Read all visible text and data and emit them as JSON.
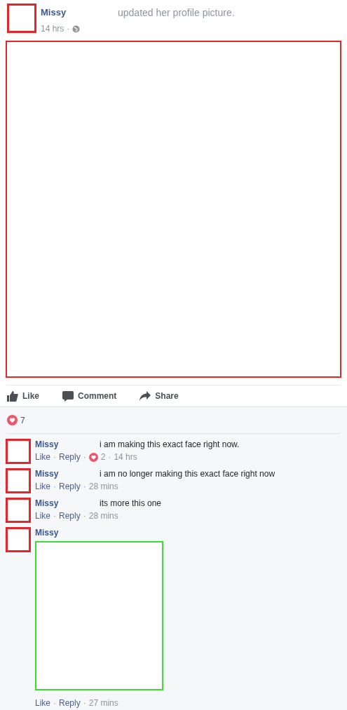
{
  "post": {
    "author": "Missy",
    "action": "updated her profile picture.",
    "time": "14 hrs",
    "separator": "·"
  },
  "actions": [
    {
      "kind": "like",
      "label": "Like"
    },
    {
      "kind": "comment",
      "label": "Comment"
    },
    {
      "kind": "share",
      "label": "Share"
    }
  ],
  "reactions": {
    "count": "7"
  },
  "comments": [
    {
      "author": "Missy",
      "kind": "text",
      "text": "i am making this exact face right now.",
      "meta": [
        {
          "kind": "link",
          "text": "Like"
        },
        {
          "kind": "sep",
          "text": "·"
        },
        {
          "kind": "link",
          "text": "Reply"
        },
        {
          "kind": "sep",
          "text": "·"
        },
        {
          "kind": "reaction",
          "text": "2"
        },
        {
          "kind": "sep",
          "text": "·"
        },
        {
          "kind": "time",
          "text": "14 hrs"
        }
      ]
    },
    {
      "author": "Missy",
      "kind": "text",
      "text": "i am no longer making this exact face right now",
      "meta": [
        {
          "kind": "link",
          "text": "Like"
        },
        {
          "kind": "sep",
          "text": "·"
        },
        {
          "kind": "link",
          "text": "Reply"
        },
        {
          "kind": "sep",
          "text": "·"
        },
        {
          "kind": "time",
          "text": "28 mins"
        }
      ]
    },
    {
      "author": "Missy",
      "kind": "text",
      "text": "its more this one",
      "meta": [
        {
          "kind": "link",
          "text": "Like"
        },
        {
          "kind": "sep",
          "text": "·"
        },
        {
          "kind": "link",
          "text": "Reply"
        },
        {
          "kind": "sep",
          "text": "·"
        },
        {
          "kind": "time",
          "text": "28 mins"
        }
      ]
    },
    {
      "author": "Missy",
      "kind": "image",
      "meta": [
        {
          "kind": "link",
          "text": "Like"
        },
        {
          "kind": "sep",
          "text": "·"
        },
        {
          "kind": "link",
          "text": "Reply"
        },
        {
          "kind": "sep",
          "text": "·"
        },
        {
          "kind": "time",
          "text": "27 mins"
        }
      ]
    }
  ]
}
